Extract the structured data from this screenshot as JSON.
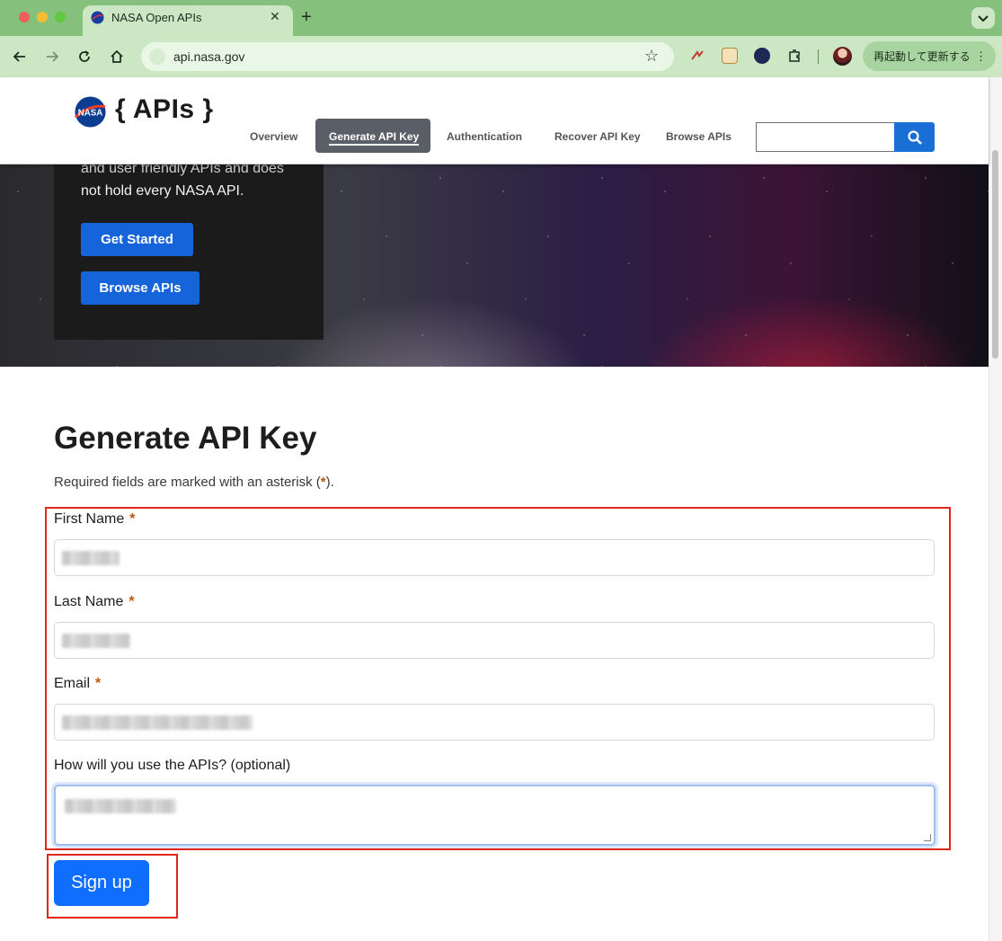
{
  "browser": {
    "tab_title": "NASA Open APIs",
    "url": "api.nasa.gov",
    "update_button": "再起動して更新する"
  },
  "site": {
    "brand": "{ APIs }",
    "nav": [
      "Overview",
      "Generate API Key",
      "Authentication",
      "Recover API Key",
      "Browse APIs"
    ],
    "active_nav": "Generate API Key"
  },
  "hero": {
    "text_faded": "and user friendly APIs and does",
    "text": "not hold every NASA API.",
    "get_started": "Get Started",
    "browse_apis": "Browse APIs"
  },
  "form": {
    "title": "Generate API Key",
    "required_note_before": "Required fields are marked with an asterisk (",
    "required_note_star": "*",
    "required_note_after": ").",
    "first_name_label": "First Name",
    "last_name_label": "Last Name",
    "email_label": "Email",
    "usage_label": "How will you use the APIs? (optional)",
    "asterisk": "*",
    "submit": "Sign up"
  },
  "colors": {
    "accent": "#0f6efd",
    "highlight": "#e2261c",
    "required": "#c05600"
  }
}
